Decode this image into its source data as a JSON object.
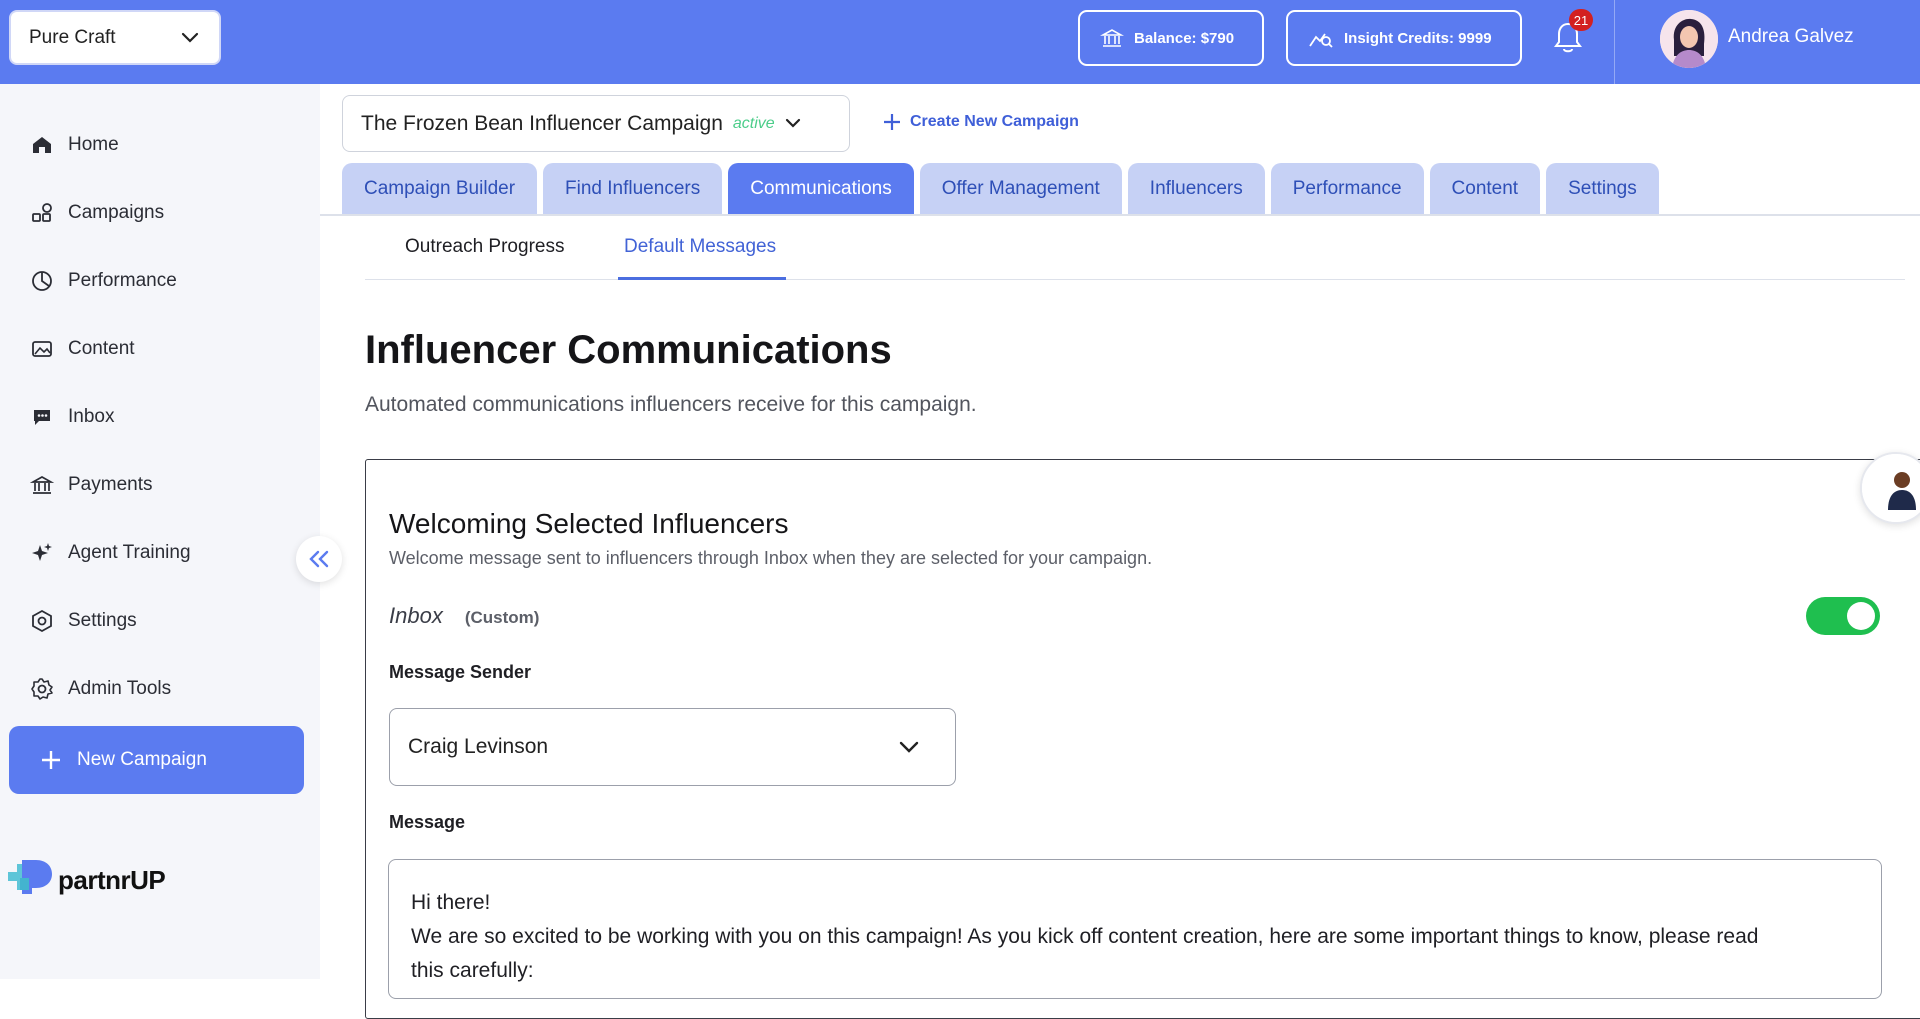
{
  "workspace": {
    "selected": "Pure Craft"
  },
  "header": {
    "balance_label": "Balance: $790",
    "credits_label": "Insight Credits: 9999",
    "notifications_count": "21",
    "user_name": "Andrea Galvez"
  },
  "sidebar": {
    "items": [
      {
        "label": "Home",
        "icon": "home-icon"
      },
      {
        "label": "Campaigns",
        "icon": "campaigns-icon"
      },
      {
        "label": "Performance",
        "icon": "pie-chart-icon"
      },
      {
        "label": "Content",
        "icon": "image-icon"
      },
      {
        "label": "Inbox",
        "icon": "chat-icon"
      },
      {
        "label": "Payments",
        "icon": "bank-icon"
      },
      {
        "label": "Agent Training",
        "icon": "sparkle-icon"
      },
      {
        "label": "Settings",
        "icon": "hexagon-settings-icon"
      },
      {
        "label": "Admin Tools",
        "icon": "gear-icon"
      }
    ],
    "new_campaign_label": "New Campaign",
    "logo_text": "partnrUP"
  },
  "campaign": {
    "name": "The Frozen Bean Influencer Campaign",
    "status": "active",
    "create_label": "Create New Campaign"
  },
  "tabs": [
    {
      "label": "Campaign Builder",
      "active": false
    },
    {
      "label": "Find Influencers",
      "active": false
    },
    {
      "label": "Communications",
      "active": true
    },
    {
      "label": "Offer Management",
      "active": false
    },
    {
      "label": "Influencers",
      "active": false
    },
    {
      "label": "Performance",
      "active": false
    },
    {
      "label": "Content",
      "active": false
    },
    {
      "label": "Settings",
      "active": false
    }
  ],
  "subtabs": [
    {
      "label": "Outreach Progress",
      "active": false
    },
    {
      "label": "Default Messages",
      "active": true
    }
  ],
  "page": {
    "title": "Influencer Communications",
    "subtitle": "Automated communications influencers receive for this campaign."
  },
  "card": {
    "title": "Welcoming Selected Influencers",
    "description": "Welcome message sent to influencers through Inbox when they are selected for your campaign.",
    "channel": "Inbox",
    "channel_tag": "(Custom)",
    "enabled": true,
    "sender_label": "Message Sender",
    "sender_value": "Craig Levinson",
    "message_label": "Message",
    "message_line1": "Hi there!",
    "message_line2": "We are so excited to be working with you on this campaign! As you kick off content creation, here are some important things to know, please read",
    "message_line3": "this carefully:"
  },
  "colors": {
    "brand": "#5b7bf0",
    "tab_inactive": "#c6d1f5",
    "toggle_on": "#1fbf4f",
    "status_active": "#4ccd8a",
    "badge": "#d32020"
  }
}
